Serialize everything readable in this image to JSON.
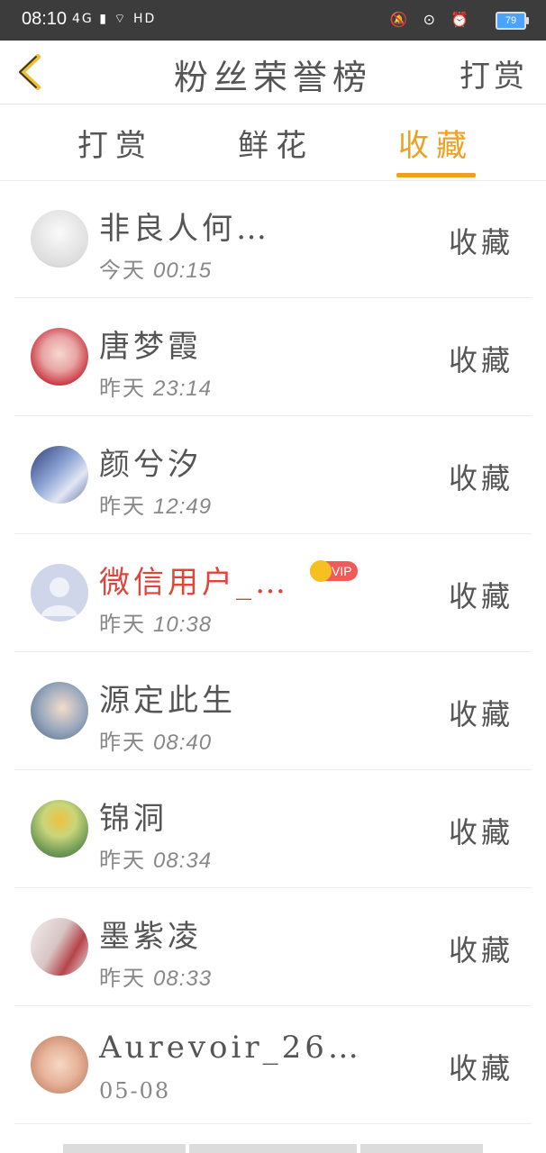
{
  "status_bar": {
    "time": "08:10",
    "left_icons": "4G ▮ ⌔ HD",
    "right_icons": "🔕 ⊙ ⏰",
    "battery": "79"
  },
  "header": {
    "title": "粉丝荣誉榜",
    "action": "打赏"
  },
  "tabs": [
    {
      "label": "打赏"
    },
    {
      "label": "鲜花"
    },
    {
      "label": "收藏",
      "active": true
    }
  ],
  "colors": {
    "accent": "#f0a020",
    "vip_red": "#e0443a"
  },
  "fans": [
    {
      "name": "非良人何…",
      "date": "今天",
      "time": "00:15",
      "action": "收藏",
      "avatar_color": "#e8e8e8"
    },
    {
      "name": "唐梦霞",
      "date": "昨天",
      "time": "23:14",
      "action": "收藏",
      "avatar_color": "#d44a5a"
    },
    {
      "name": "颜兮汐",
      "date": "昨天",
      "time": "12:49",
      "action": "收藏",
      "avatar_color": "#6a7fb0"
    },
    {
      "name": "微信用户_…",
      "date": "昨天",
      "time": "10:38",
      "action": "收藏",
      "vip": "VIP",
      "avatar_color": "#c8d0e6"
    },
    {
      "name": "源定此生",
      "date": "昨天",
      "time": "08:40",
      "action": "收藏",
      "avatar_color": "#9bb0c8"
    },
    {
      "name": "锦洞",
      "date": "昨天",
      "time": "08:34",
      "action": "收藏",
      "avatar_color": "#b5c36a"
    },
    {
      "name": "墨紫凌",
      "date": "昨天",
      "time": "08:33",
      "action": "收藏",
      "avatar_color": "#d8c8c8"
    },
    {
      "name": "Aurevoir_26…",
      "date": "05-08",
      "time": "",
      "action": "收藏",
      "avatar_color": "#e7b49a"
    }
  ]
}
